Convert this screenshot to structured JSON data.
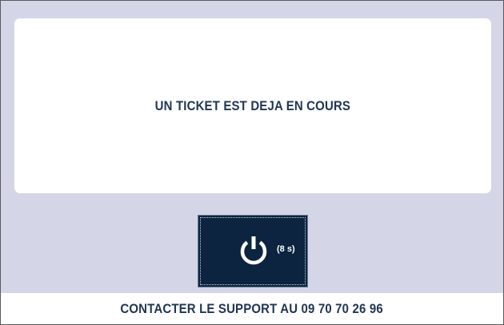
{
  "message": {
    "text": "UN TICKET EST DEJA EN COURS"
  },
  "power_button": {
    "icon": "power-icon",
    "countdown": "(8 s)"
  },
  "support": {
    "text": "CONTACTER LE SUPPORT AU 09 70 70 26 96"
  },
  "colors": {
    "background": "#d4d6e8",
    "card": "#ffffff",
    "text": "#1f3554",
    "button": "#0d2440"
  }
}
